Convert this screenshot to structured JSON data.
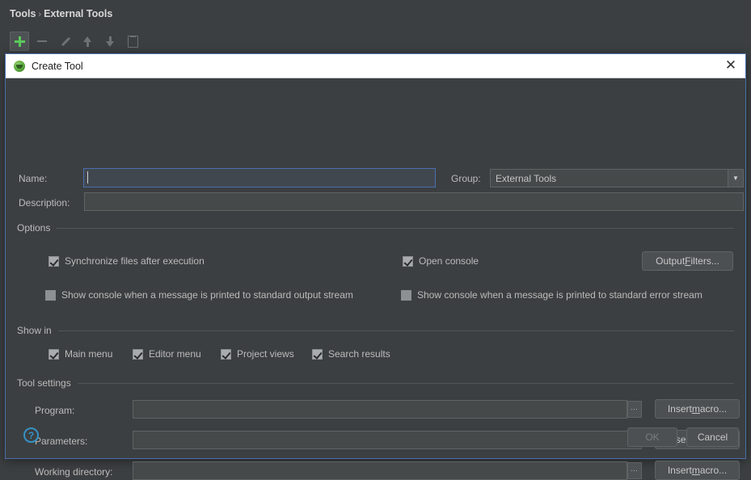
{
  "background": {
    "breadcrumb": {
      "root": "Tools",
      "separator": "›",
      "current": "External Tools"
    },
    "toolbar": [
      {
        "name": "add-button",
        "icon": "plus-icon",
        "state": "selected"
      },
      {
        "name": "remove-button",
        "icon": "minus-icon",
        "state": "disabled"
      },
      {
        "name": "edit-button",
        "icon": "pencil-icon",
        "state": "disabled"
      },
      {
        "name": "move-up-button",
        "icon": "arrow-up-icon",
        "state": "disabled"
      },
      {
        "name": "move-down-button",
        "icon": "arrow-down-icon",
        "state": "disabled"
      },
      {
        "name": "copy-button",
        "icon": "copy-icon",
        "state": "disabled"
      }
    ]
  },
  "dialog": {
    "title": "Create Tool",
    "title_icon": "intellij-tool-icon",
    "close_icon": "close-icon",
    "name": {
      "label": "Name:",
      "value": "",
      "placeholder": ""
    },
    "group": {
      "label": "Group:",
      "value": "External Tools",
      "options": [
        "External Tools"
      ],
      "arrow_icon": "chevron-down-icon"
    },
    "description": {
      "label": "Description:",
      "value": "",
      "placeholder": ""
    },
    "options": {
      "title": "Options",
      "checkboxes": [
        {
          "label": "Synchronize files after execution",
          "checked": true
        },
        {
          "label": "Open console",
          "checked": true
        },
        {
          "label": "Show console when a message is printed to standard output stream",
          "checked": false
        },
        {
          "label": "Show console when a message is printed to standard error stream",
          "checked": false
        }
      ],
      "output_filters_button": {
        "pre": "Output ",
        "mnemonic": "F",
        "post": "ilters..."
      }
    },
    "show_in": {
      "title": "Show in",
      "checkboxes": [
        {
          "label": "Main menu",
          "checked": true
        },
        {
          "label": "Editor menu",
          "checked": true
        },
        {
          "label": "Project views",
          "checked": true
        },
        {
          "label": "Search results",
          "checked": true
        }
      ]
    },
    "tool_settings": {
      "title": "Tool settings",
      "rows": [
        {
          "label": "Program:",
          "value": "",
          "has_browse": true,
          "browse_icon": "ellipsis-icon",
          "macro_button": {
            "pre": "Insert ",
            "mnemonic": "m",
            "post": "acro..."
          }
        },
        {
          "label": "Parameters:",
          "value": "",
          "has_browse": false,
          "browse_icon": "",
          "macro_button": {
            "pre": "Insert ",
            "mnemonic": "m",
            "post": "acro..."
          }
        },
        {
          "label": "Working directory:",
          "value": "",
          "has_browse": true,
          "browse_icon": "ellipsis-icon",
          "macro_button": {
            "pre": "Insert ",
            "mnemonic": "m",
            "post": "acro..."
          }
        }
      ]
    },
    "footer": {
      "help_label": "?",
      "ok_label": "OK",
      "ok_enabled": false,
      "cancel_label": "Cancel"
    }
  },
  "colors": {
    "window_bg": "#3c3f41",
    "dialog_border": "#4b6eaf",
    "titlebar_bg": "#ffffff",
    "accent_green": "#5aca5a",
    "help_blue": "#3592c4",
    "text": "#bbbbbb"
  }
}
